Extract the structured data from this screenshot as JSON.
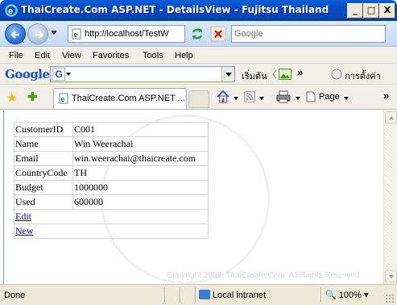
{
  "window": {
    "title": "ThaiCreate.Com ASP.NET - DetailsView - Fujitsu Thailand",
    "controls": {
      "minimize": "_",
      "maximize": "□",
      "close": "X"
    }
  },
  "addressbar": {
    "url": "http://localhost/TestW",
    "search_placeholder": "Google"
  },
  "menu": {
    "items": [
      "File",
      "Edit",
      "View",
      "Favorites",
      "Tools",
      "Help"
    ]
  },
  "google_toolbar": {
    "logo": "Google",
    "search_icon_label": "G",
    "start_label": "เริ่มต้น",
    "more_label": "»",
    "settings_label": "การตั้งค่า"
  },
  "tabs": {
    "active_label": "ThaiCreate.Com ASP.NET ...",
    "page_label": "Page",
    "more_label": "»"
  },
  "details": {
    "rows": [
      {
        "label": "CustomerID",
        "value": "C001"
      },
      {
        "label": "Name",
        "value": "Win Weerachai"
      },
      {
        "label": "Email",
        "value": "win.weerachai@thaicreate.com"
      },
      {
        "label": "CountryCode",
        "value": "TH"
      },
      {
        "label": "Budget",
        "value": "1000000"
      },
      {
        "label": "Used",
        "value": "600000"
      }
    ],
    "edit_link": "Edit",
    "new_link": "New"
  },
  "watermark": {
    "copyright": "Copyright 2009, ThaiCreate.Com. All Rights Reserved."
  },
  "status": {
    "text": "Done",
    "zone": "Local intranet",
    "zoom": "100%"
  }
}
